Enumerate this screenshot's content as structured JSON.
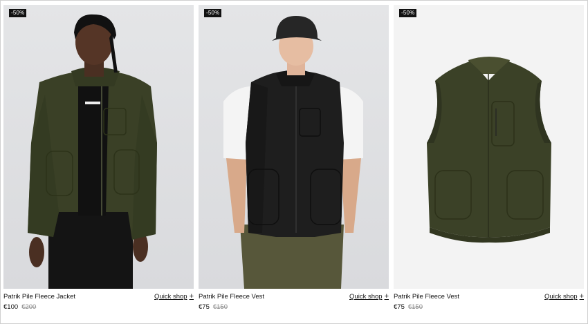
{
  "products": [
    {
      "name": "Patrik Pile Fleece Jacket",
      "badge": "-50%",
      "price": "€100",
      "old_price": "€200",
      "quick_shop": "Quick shop",
      "plus": "+"
    },
    {
      "name": "Patrik Pile Fleece Vest",
      "badge": "-50%",
      "price": "€75",
      "old_price": "€150",
      "quick_shop": "Quick shop",
      "plus": "+"
    },
    {
      "name": "Patrik Pile Fleece Vest",
      "badge": "-50%",
      "price": "€75",
      "old_price": "€150",
      "quick_shop": "Quick shop",
      "plus": "+"
    }
  ],
  "colors": {
    "fleece_green": "#3b4127",
    "fleece_black": "#1e1e1e",
    "sale_badge": "#111111"
  }
}
